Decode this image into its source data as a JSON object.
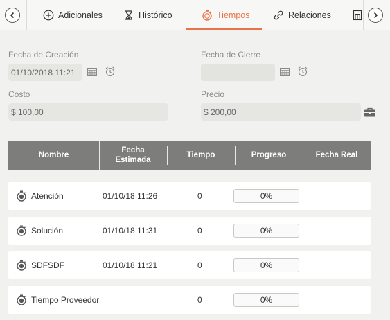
{
  "tabs": [
    {
      "label": "Adicionales",
      "icon": "plus-circle-icon",
      "active": false
    },
    {
      "label": "Histórico",
      "icon": "hourglass-icon",
      "active": false
    },
    {
      "label": "Tiempos",
      "icon": "stopwatch-icon",
      "active": true
    },
    {
      "label": "Relaciones",
      "icon": "link-icon",
      "active": false
    }
  ],
  "colors": {
    "accent": "#e8734a",
    "header_bg": "#7d7d7b"
  },
  "form": {
    "fecha_creacion_label": "Fecha de Creación",
    "fecha_creacion_value": "01/10/2018 11:21",
    "fecha_cierre_label": "Fecha de Cierre",
    "fecha_cierre_value": "",
    "costo_label": "Costo",
    "costo_value": "$ 100,00",
    "precio_label": "Precio",
    "precio_value": "$ 200,00"
  },
  "table": {
    "headers": {
      "nombre": "Nombre",
      "fecha_estimada_1": "Fecha",
      "fecha_estimada_2": "Estimada",
      "tiempo": "Tiempo",
      "progreso": "Progreso",
      "fecha_real": "Fecha Real"
    },
    "rows": [
      {
        "nombre": "Atención",
        "fecha": "01/10/18 11:26",
        "tiempo": "0",
        "progreso_label": "0%",
        "progreso": 0,
        "fecha_real": ""
      },
      {
        "nombre": "Solución",
        "fecha": "01/10/18 11:31",
        "tiempo": "0",
        "progreso_label": "0%",
        "progreso": 0,
        "fecha_real": ""
      },
      {
        "nombre": "SDFSDF",
        "fecha": "01/10/18 11:21",
        "tiempo": "0",
        "progreso_label": "0%",
        "progreso": 0,
        "fecha_real": ""
      },
      {
        "nombre": "Tiempo Proveedor",
        "fecha": "",
        "tiempo": "0",
        "progreso_label": "0%",
        "progreso": 0,
        "fecha_real": ""
      }
    ]
  }
}
